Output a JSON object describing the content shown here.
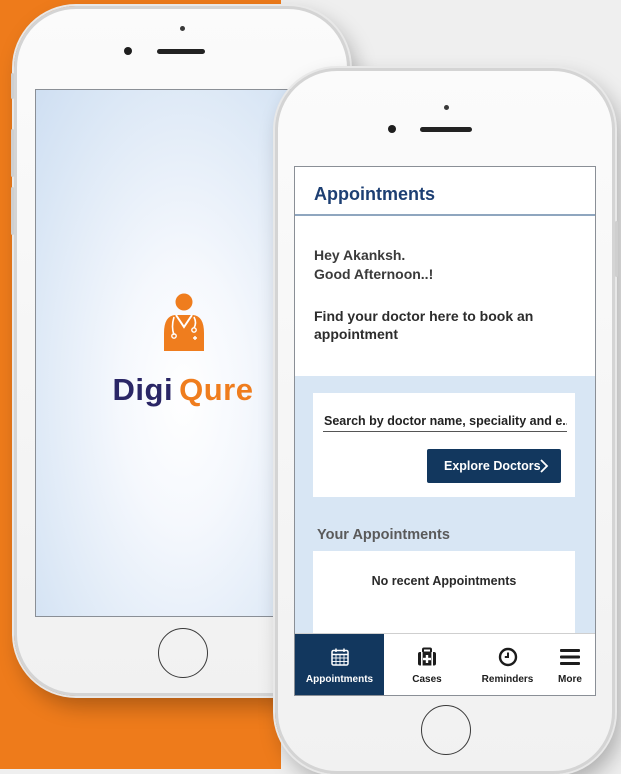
{
  "colors": {
    "orange_background": "#ee7b1b",
    "page_background": "#efefef",
    "brand_navy": "#2a2666",
    "brand_orange": "#ef7d1e",
    "app_primary": "#12375e",
    "title_blue": "#1d3f73",
    "section_blue": "#d8e6f4"
  },
  "splash": {
    "logo_icon": "doctor-stethoscope-icon",
    "brand_part1": "Digi",
    "brand_part2": "Qure"
  },
  "app": {
    "title": "Appointments",
    "greeting_line1": "Hey Akanksh.",
    "greeting_line2": "Good Afternoon..!",
    "find_doctor_text": "Find your doctor here to book an appointment",
    "search": {
      "placeholder": "Search by doctor name, speciality and e.."
    },
    "explore_button": {
      "label": "Explore Doctors",
      "icon": "chevron-right-icon"
    },
    "your_appointments_heading": "Your Appointments",
    "empty_appointments_text": "No recent Appointments",
    "bottom_nav": [
      {
        "label": "Appointments",
        "icon": "calendar-icon",
        "active": true
      },
      {
        "label": "Cases",
        "icon": "medical-case-icon",
        "active": false
      },
      {
        "label": "Reminders",
        "icon": "clock-icon",
        "active": false
      },
      {
        "label": "More",
        "icon": "hamburger-menu-icon",
        "active": false
      }
    ]
  }
}
